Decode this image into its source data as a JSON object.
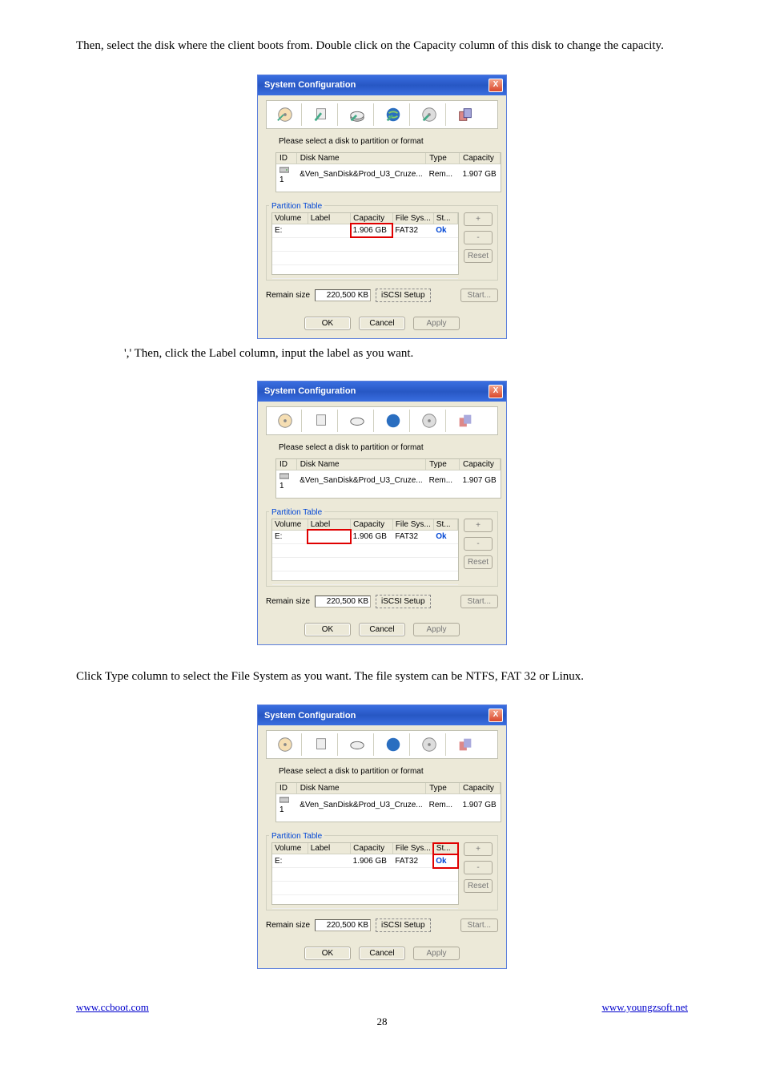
{
  "intro_text": "Then, select the disk where the client boots from. Double click on the Capacity column of this disk to change the capacity.",
  "caption1": "',' Then, click the Label column, input the label as you want.",
  "caption2": "Click Type column to select the File System as you want. The file system can be NTFS, FAT 32 or Linux.",
  "dialog": {
    "title": "System Configuration",
    "close_symbol": "X",
    "instruction": "Please select a disk to partition or format",
    "disk_table": {
      "headers": [
        "ID",
        "Disk Name",
        "Type",
        "Capacity"
      ],
      "row": {
        "icon": "1",
        "name": "&Ven_SanDisk&Prod_U3_Cruze...",
        "type": "Rem...",
        "capacity": "1.907 GB"
      }
    },
    "partition_title": "Partition Table",
    "part_headers": [
      "Volume",
      "Label",
      "Capacity",
      "File Sys...",
      "St..."
    ],
    "part_row": {
      "volume": "E:",
      "label": "",
      "capacity": "1.906 GB",
      "fs": "FAT32",
      "status": "Ok"
    },
    "side_buttons": {
      "plus": "+",
      "minus": "-",
      "reset": "Reset"
    },
    "remain_label": "Remain size",
    "remain_value": "220,500 KB",
    "iscsi_label": "iSCSI Setup",
    "start_label": "Start...",
    "btn_ok": "OK",
    "btn_cancel": "Cancel",
    "btn_apply": "Apply"
  },
  "footer": {
    "left": "www.ccboot.com",
    "right": "www.youngzsoft.net",
    "page": "28"
  },
  "highlights": {
    "d1": "capacity-cell",
    "d2": "label-cell",
    "d3": "status-cell"
  }
}
